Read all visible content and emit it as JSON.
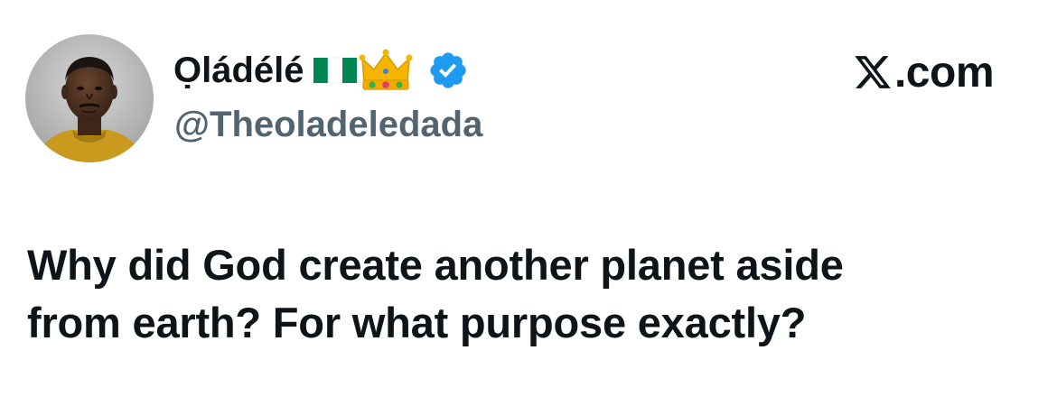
{
  "author": {
    "display_name": "Ọládélé",
    "handle": "@Theoladeledada",
    "avatar_icon": "profile-photo",
    "flag_icon": "nigeria-flag-icon",
    "crown_icon": "crown-emoji-icon",
    "verified_icon": "verified-badge-icon",
    "verified_color": "#1d9bf0"
  },
  "brand": {
    "logo_icon": "x-logo-icon",
    "text": ".com"
  },
  "tweet": {
    "lines": [
      "Why did God create another planet aside",
      "from earth? For what purpose exactly?"
    ]
  },
  "colors": {
    "text_primary": "#0f1419",
    "text_secondary": "#536471",
    "background": "#ffffff"
  }
}
